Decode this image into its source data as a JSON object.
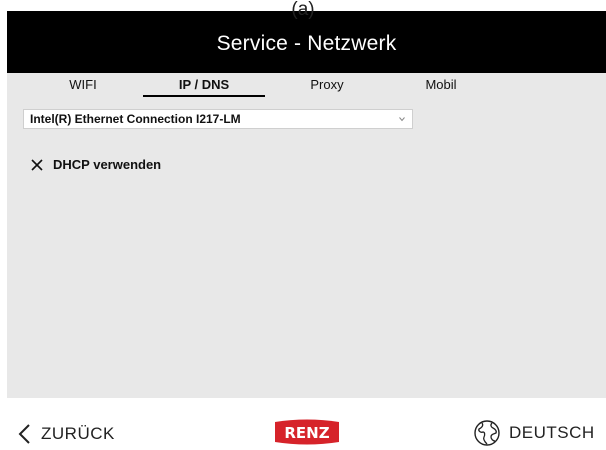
{
  "caption": "(a)",
  "header": {
    "title": "Service - Netzwerk"
  },
  "tabs": [
    {
      "label": "WIFI",
      "active": false
    },
    {
      "label": "IP / DNS",
      "active": true
    },
    {
      "label": "Proxy",
      "active": false
    },
    {
      "label": "Mobil",
      "active": false
    }
  ],
  "adapter_select": {
    "value": "Intel(R) Ethernet Connection I217-LM",
    "icon": "chevron-down-icon"
  },
  "dhcp": {
    "label": "DHCP verwenden",
    "checked": true,
    "icon": "x-mark-icon"
  },
  "footer": {
    "back_label": "ZURÜCK",
    "back_icon": "chevron-left-icon",
    "logo_text": "RENZ",
    "language_label": "DEUTSCH",
    "language_icon": "globe-icon"
  },
  "colors": {
    "header_bg": "#000000",
    "content_bg": "#e8e8e8",
    "logo_red": "#d6232a"
  }
}
